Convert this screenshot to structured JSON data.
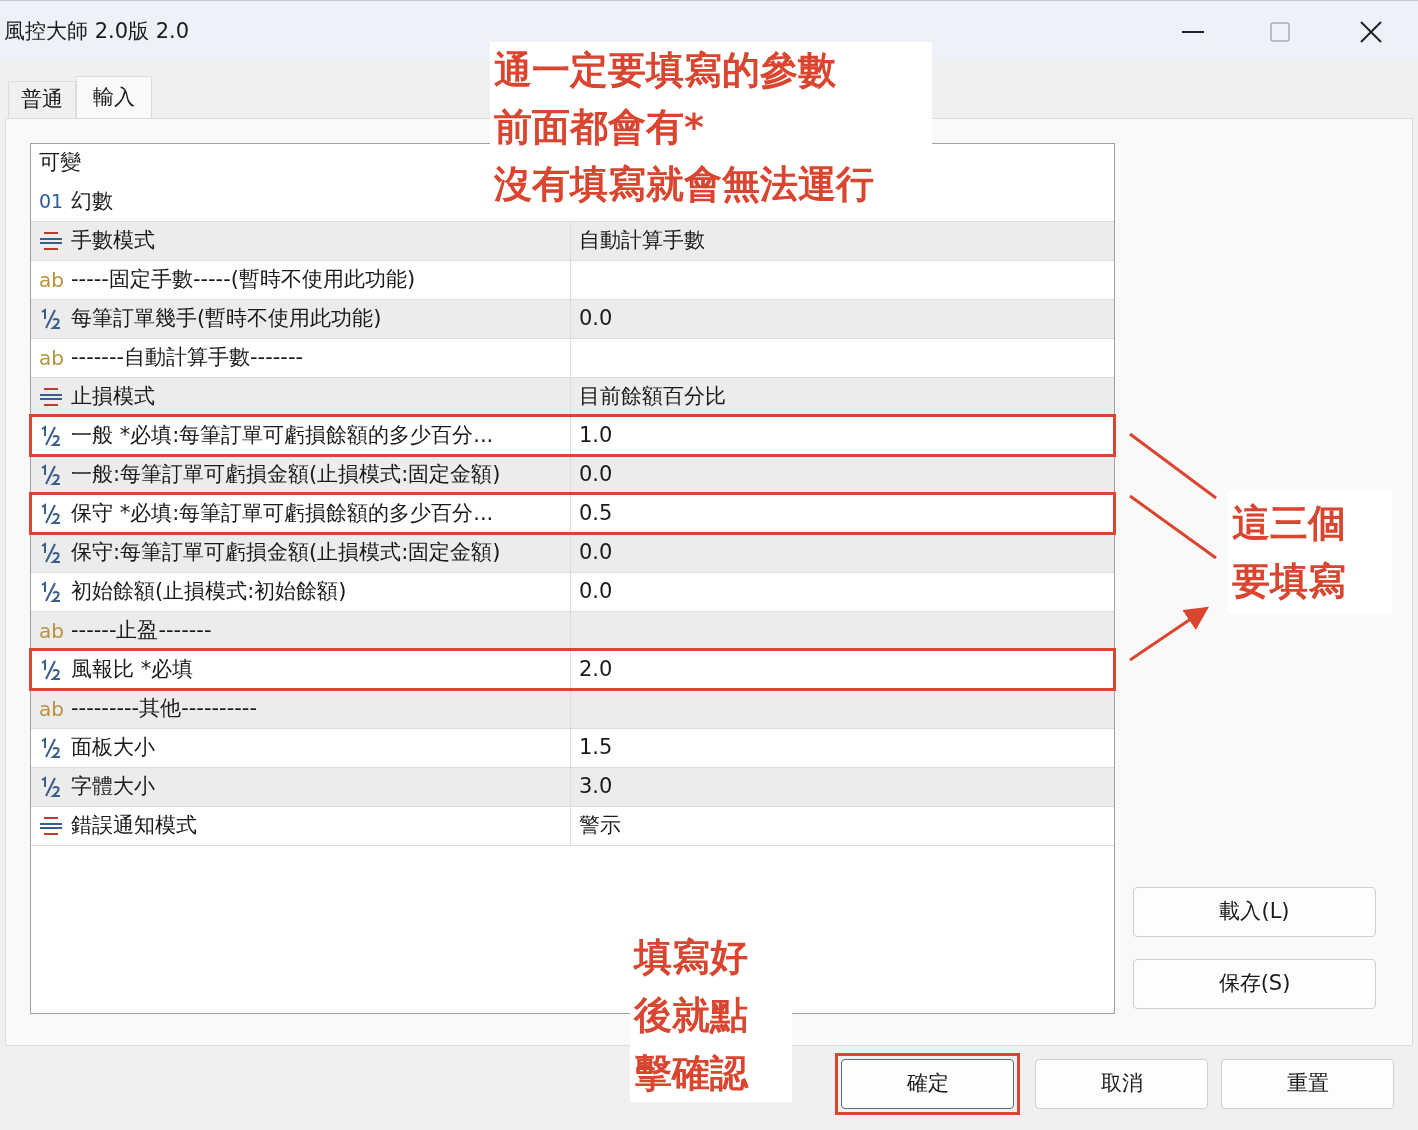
{
  "window": {
    "title": "風控大師 2.0版 2.0"
  },
  "tabs": [
    {
      "label": "普通",
      "selected": false
    },
    {
      "label": "輸入",
      "selected": true
    }
  ],
  "group": {
    "label": "可變"
  },
  "magic_row": {
    "kind": "int",
    "icon": "01",
    "label": "幻數"
  },
  "rows": [
    {
      "kind": "enum",
      "name": "手數模式",
      "value": "自動計算手數",
      "highlighted": false
    },
    {
      "kind": "string",
      "icon": "ab",
      "name": "-----固定手數-----(暫時不使用此功能)",
      "highlighted": false
    },
    {
      "kind": "double",
      "name": "每筆訂單幾手(暫時不使用此功能)",
      "value": "0.0",
      "highlighted": false
    },
    {
      "kind": "string",
      "icon": "ab",
      "name": "-------自動計算手數-------",
      "highlighted": false
    },
    {
      "kind": "enum",
      "name": "止損模式",
      "value": "目前餘額百分比",
      "highlighted": false
    },
    {
      "kind": "double",
      "name": "一般 *必填:每筆訂單可虧損餘額的多少百分...",
      "value": "1.0",
      "highlighted": true
    },
    {
      "kind": "double",
      "name": "一般:每筆訂單可虧損金額(止損模式:固定金額)",
      "value": "0.0",
      "highlighted": false
    },
    {
      "kind": "double",
      "name": "保守 *必填:每筆訂單可虧損餘額的多少百分...",
      "value": "0.5",
      "highlighted": true
    },
    {
      "kind": "double",
      "name": "保守:每筆訂單可虧損金額(止損模式:固定金額)",
      "value": "0.0",
      "highlighted": false
    },
    {
      "kind": "double",
      "name": "初始餘額(止損模式:初始餘額)",
      "value": "0.0",
      "highlighted": false
    },
    {
      "kind": "string",
      "icon": "ab",
      "name": "------止盈-------",
      "highlighted": false
    },
    {
      "kind": "double",
      "name": "風報比 *必填",
      "value": "2.0",
      "highlighted": true
    },
    {
      "kind": "string",
      "icon": "ab",
      "name": "---------其他----------",
      "highlighted": false
    },
    {
      "kind": "double",
      "name": "面板大小",
      "value": "1.5",
      "highlighted": false
    },
    {
      "kind": "double",
      "name": "字體大小",
      "value": "3.0",
      "highlighted": false
    },
    {
      "kind": "enum",
      "name": "錯誤通知模式",
      "value": "警示",
      "highlighted": false
    }
  ],
  "side_buttons": [
    "載入(L)",
    "保存(S)"
  ],
  "footer_buttons": [
    {
      "label": "確定",
      "highlighted": true
    },
    {
      "label": "取消",
      "highlighted": false
    },
    {
      "label": "重置",
      "highlighted": false
    }
  ],
  "annotations": [
    {
      "kind": "top",
      "lines": [
        "通一定要填寫的參數",
        "前面都會有*",
        "沒有填寫就會無法運行"
      ]
    },
    {
      "kind": "right",
      "lines": [
        "這三個",
        "要填寫"
      ]
    },
    {
      "kind": "bottom",
      "lines": [
        "填寫好",
        "後就點",
        "擊確認"
      ]
    }
  ]
}
